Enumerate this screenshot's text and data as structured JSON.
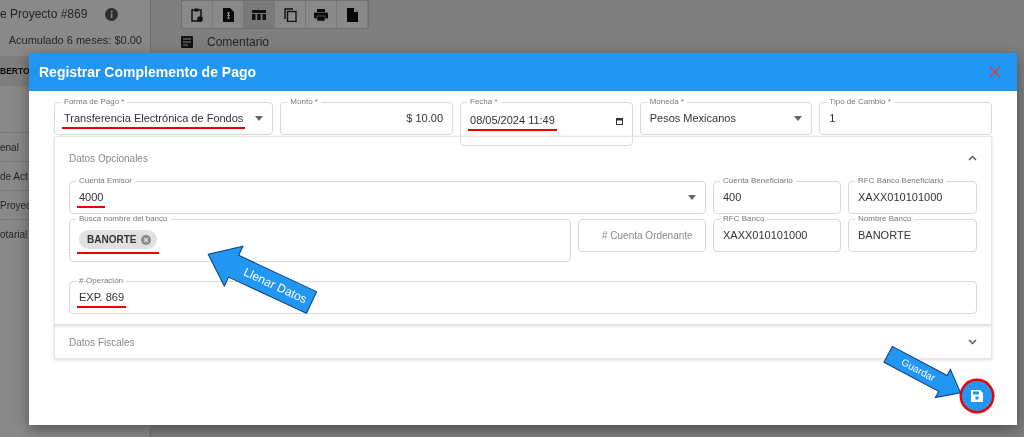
{
  "background": {
    "project_title": "e Proyecto #869",
    "accumulated": "Acumulado 6 meses: $0.00",
    "client": "BERTO",
    "comment_label": "Comentario",
    "toolbar": [
      {
        "selected": false
      },
      {
        "selected": false
      },
      {
        "selected": true
      },
      {
        "selected": false
      },
      {
        "selected": false
      },
      {
        "selected": false
      }
    ],
    "sidebar_fragments": [
      "enal",
      "de Act",
      "Proyec",
      "otarial"
    ]
  },
  "modal": {
    "title": "Registrar Complemento de Pago",
    "fields": [
      {
        "kind": "select",
        "label": "Forma de Pago *",
        "value": "Transferencia Electrónica de Fondos",
        "highlighted": true
      },
      {
        "kind": "amount",
        "label": "Monto *",
        "value": "$ 10.00",
        "highlighted": false
      },
      {
        "kind": "date",
        "label": "Fecha *",
        "value": "08/05/2024 11:49",
        "highlighted": true
      },
      {
        "kind": "select",
        "label": "Moneda *",
        "value": "Pesos Mexicanos",
        "highlighted": false
      },
      {
        "kind": "text",
        "label": "Tipo de Cambio *",
        "value": "1",
        "highlighted": false
      }
    ],
    "optional_panel": {
      "title": "Datos Opcionales",
      "expanded": true,
      "fields": [
        {
          "kind": "select",
          "label": "Cuenta Emisor",
          "value": "4000",
          "highlighted": true
        },
        {
          "kind": "text",
          "label": "Cuenta Beneficiario",
          "value": "400",
          "highlighted": false
        },
        {
          "kind": "text",
          "label": "RFC Banco Beneficiario",
          "value": "XAXX010101000",
          "highlighted": false
        },
        {
          "kind": "chips",
          "label": "Busca nombre del banco",
          "chips": [
            "BANORTE"
          ],
          "highlighted": true
        },
        {
          "kind": "text",
          "placeholder": "# Cuenta Ordenante",
          "highlighted": false
        },
        {
          "kind": "text",
          "label": "RFC Banco",
          "value": "XAXX010101000",
          "highlighted": false
        },
        {
          "kind": "text",
          "label": "Nombre Banco",
          "value": "BANORTE",
          "highlighted": false
        },
        {
          "kind": "text",
          "label": "#-Operación",
          "value": "EXP. 869",
          "highlighted": true
        }
      ]
    },
    "fiscal_panel": {
      "title": "Datos Fiscales",
      "expanded": false
    },
    "save_highlighted": true
  },
  "callouts": [
    {
      "text": "Llenar Datos"
    },
    {
      "text": "Guardar"
    }
  ]
}
